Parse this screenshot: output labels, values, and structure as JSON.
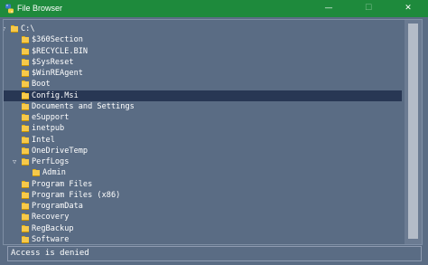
{
  "window": {
    "title": "File Browser",
    "minimize_glyph": "—",
    "maximize_glyph": "☐",
    "close_glyph": "✕",
    "title_bar_color": "#1e8a3c"
  },
  "tree": {
    "root": {
      "label": "C:\\",
      "expanded": true,
      "toggle_glyph": "▽"
    },
    "items": [
      {
        "label": "$360Section",
        "selected": false
      },
      {
        "label": "$RECYCLE.BIN",
        "selected": false
      },
      {
        "label": "$SysReset",
        "selected": false
      },
      {
        "label": "$WinREAgent",
        "selected": false
      },
      {
        "label": "Boot",
        "selected": false
      },
      {
        "label": "Config.Msi",
        "selected": true
      },
      {
        "label": "Documents and Settings",
        "selected": false
      },
      {
        "label": "eSupport",
        "selected": false
      },
      {
        "label": "inetpub",
        "selected": false
      },
      {
        "label": "Intel",
        "selected": false
      },
      {
        "label": "OneDriveTemp",
        "selected": false
      },
      {
        "label": "PerfLogs",
        "selected": false,
        "expanded": true,
        "toggle_glyph": "▽",
        "children": [
          {
            "label": "Admin"
          }
        ]
      },
      {
        "label": "Program Files",
        "selected": false
      },
      {
        "label": "Program Files (x86)",
        "selected": false
      },
      {
        "label": "ProgramData",
        "selected": false
      },
      {
        "label": "Recovery",
        "selected": false
      },
      {
        "label": "RegBackup",
        "selected": false
      },
      {
        "label": "Software",
        "selected": false
      }
    ],
    "selection_color": "#283754",
    "folder_color": "#f7c94a"
  },
  "status": {
    "text": "Access is denied"
  }
}
